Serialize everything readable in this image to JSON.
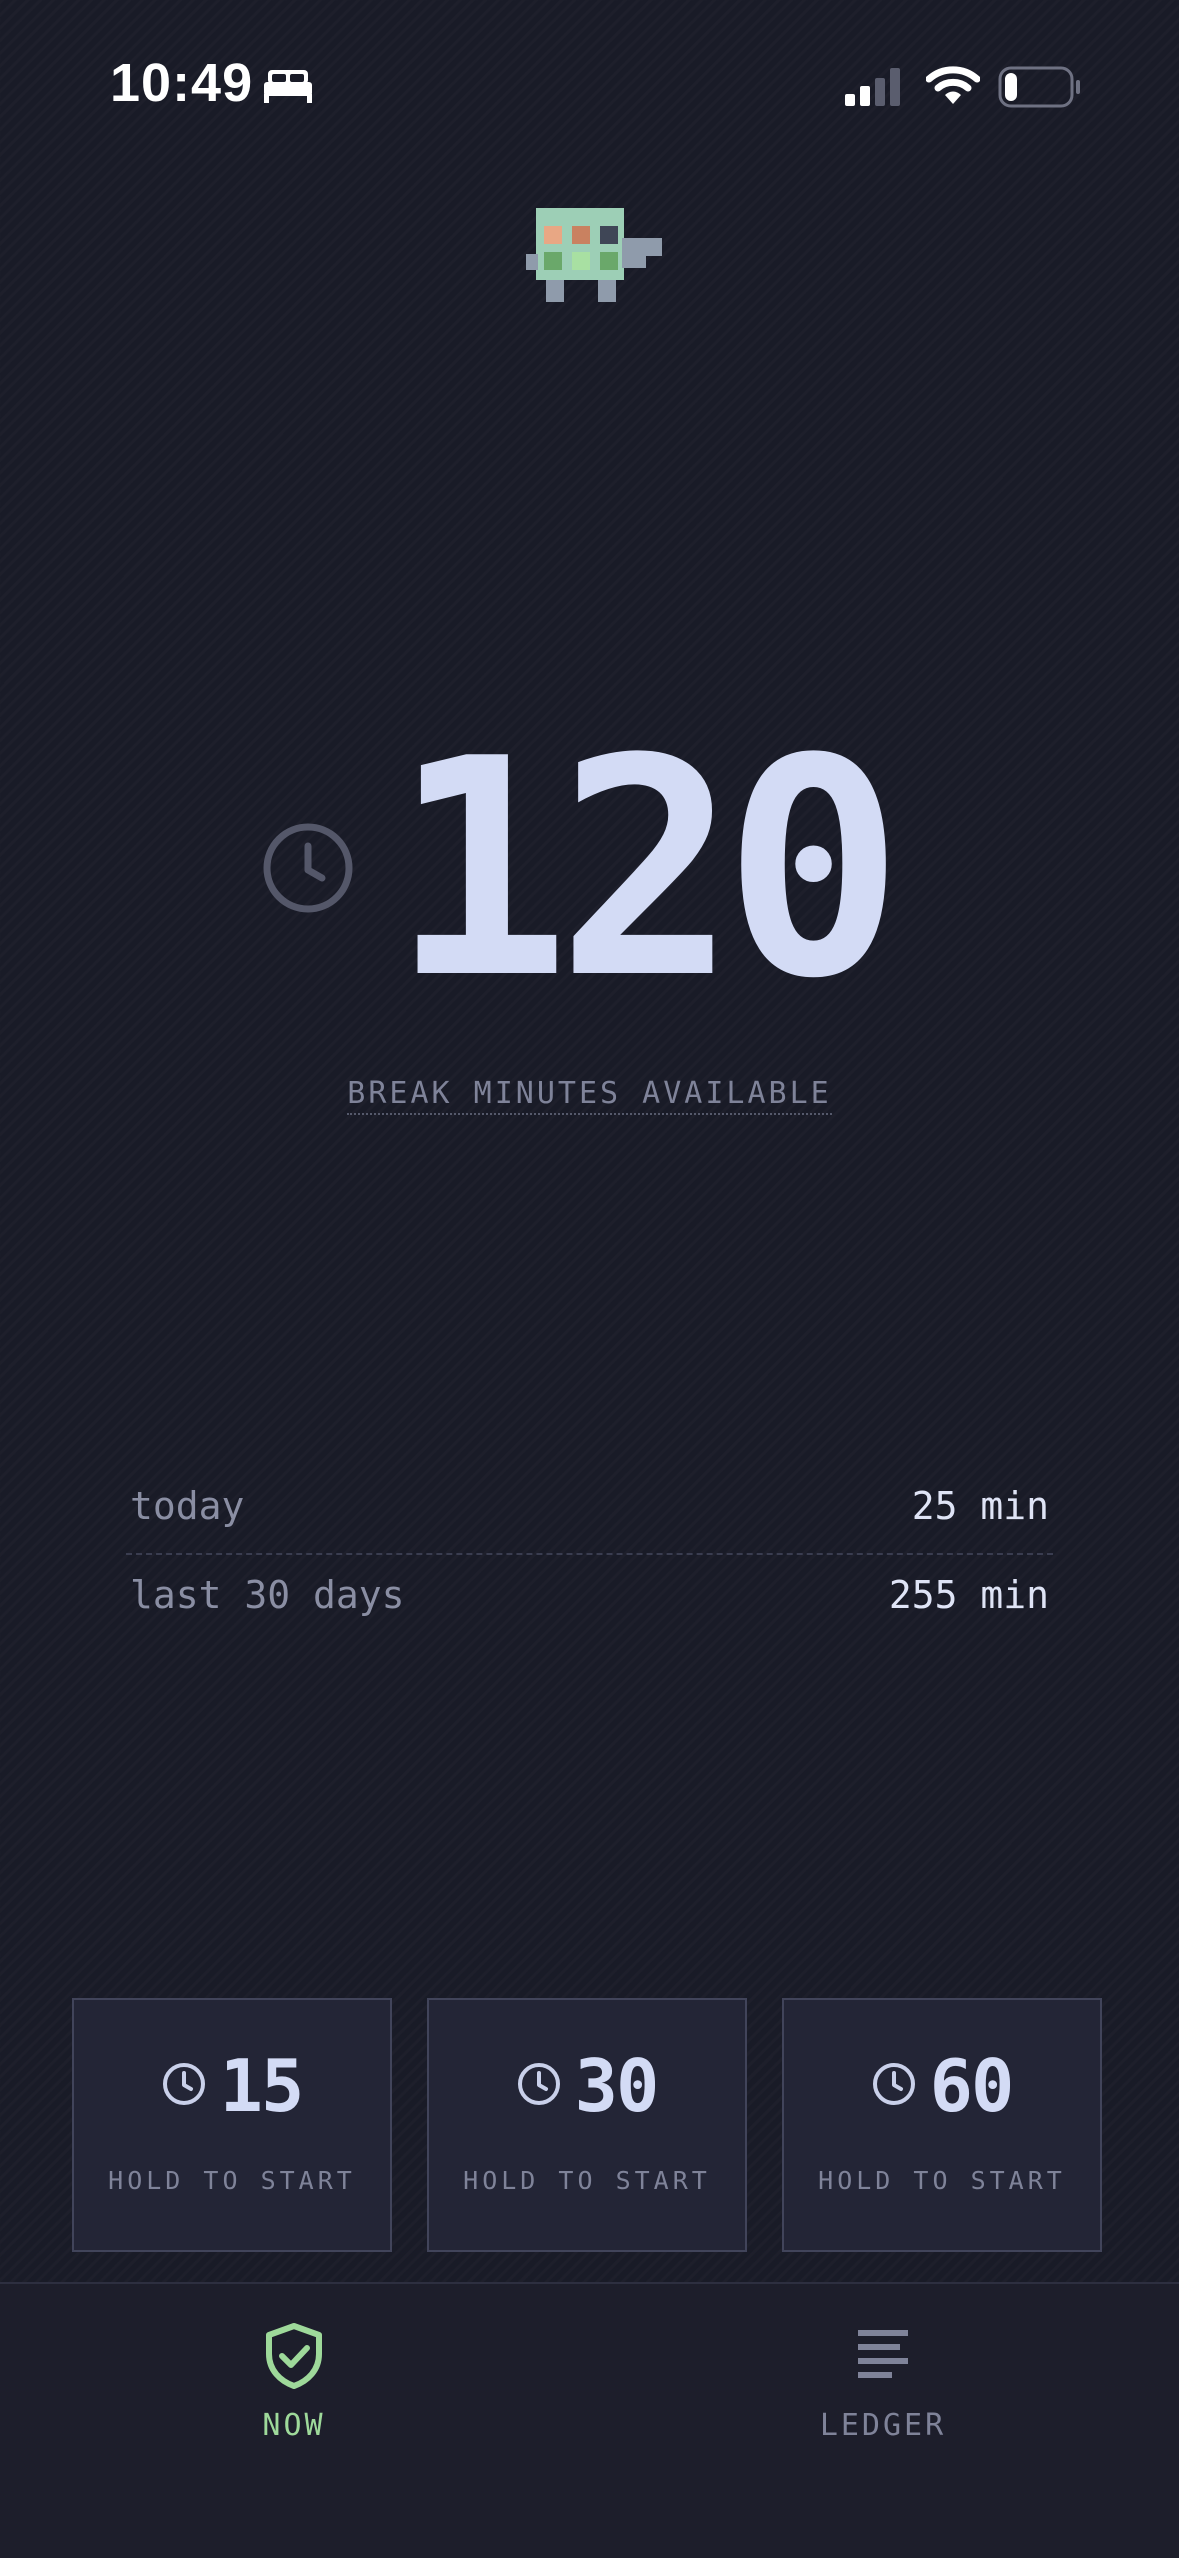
{
  "status_bar": {
    "time": "10:49",
    "focus_icon": "bed-icon",
    "signal_icon": "cellular-signal-icon",
    "wifi_icon": "wifi-icon",
    "battery_icon": "battery-icon",
    "battery_level": 0.2
  },
  "hero": {
    "mascot_icon": "pixel-turtle-icon",
    "clock_icon": "clock-icon",
    "minutes": "120",
    "label": "BREAK MINUTES AVAILABLE"
  },
  "stats": [
    {
      "label": "today",
      "value": "25 min"
    },
    {
      "label": "last 30 days",
      "value": "255 min"
    }
  ],
  "break_options": [
    {
      "minutes": "15",
      "label": "HOLD TO START"
    },
    {
      "minutes": "30",
      "label": "HOLD TO START"
    },
    {
      "minutes": "60",
      "label": "HOLD TO START"
    }
  ],
  "tabs": [
    {
      "label": "NOW",
      "icon": "shield-check-icon",
      "active": true
    },
    {
      "label": "LEDGER",
      "icon": "ledger-lines-icon",
      "active": false
    }
  ],
  "colors": {
    "background": "#191b27",
    "primary_text": "#d3dbf5",
    "muted_text": "#7f8399",
    "accent_green": "#9ed99a",
    "card_background": "#232536"
  }
}
